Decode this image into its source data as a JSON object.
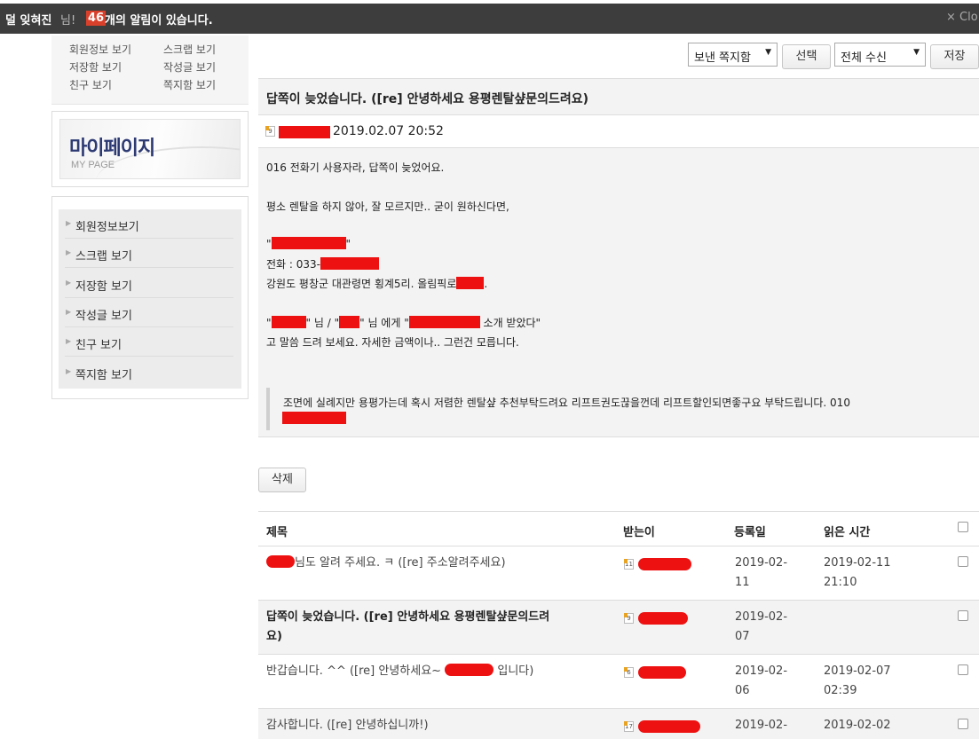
{
  "topbar": {
    "user_name": "덜 잊혀진",
    "user_suffix": "님!",
    "alert_count": "46",
    "alert_text": "개의 알림이 있습니다.",
    "close_label": "× Clo"
  },
  "sidebar": {
    "quick_links": [
      "회원정보 보기",
      "스크랩 보기",
      "저장함 보기",
      "작성글 보기",
      "친구 보기",
      "쪽지함 보기"
    ],
    "mypage_title": "마이페이지",
    "mypage_subtitle": "MY PAGE",
    "menu": [
      "회원정보보기",
      "스크랩 보기",
      "저장함 보기",
      "작성글 보기",
      "친구 보기",
      "쪽지함 보기"
    ]
  },
  "toolbar": {
    "box_select_value": "보낸 쪽지함",
    "select_button": "선택",
    "receive_select_value": "전체 수신",
    "save_button": "저장"
  },
  "message": {
    "title": "답쪽이 늦었습니다. ([re] 안녕하세요 용평렌탈샾문의드려요)",
    "datetime": "2019.02.07 20:52",
    "sender_level": "9",
    "lines": {
      "l1": "016 전화기 사용자라, 답쪽이 늦었어요.",
      "l2": "평소 렌탈을 하지 않아, 잘 모르지만.. 굳이 원하신다면,",
      "l3_open": "\"",
      "l3_close": "\"",
      "l4": "전화 : 033-",
      "l5": "강원도 평창군 대관령면 횡계5리. 올림픽로",
      "l5_end": ".",
      "l6_a": "\"",
      "l6_b": "\" 님 / \"",
      "l6_c": "\" 님 에게 \"",
      "l6_d": " 소개 받았다\"",
      "l7": "고 말씀 드려 보세요. 자세한 금액이나.. 그런건 모릅니다."
    },
    "quote": "조면에 실례지만 용평가는데 혹시 저렴한 렌탈샾 추천부탁드려요 리프트권도끊을껀데 리프트할인되면좋구요 부탁드립니다. 010"
  },
  "delete_button": "삭제",
  "table": {
    "headers": [
      "제목",
      "받는이",
      "등록일",
      "읽은 시간"
    ],
    "rows": [
      {
        "subject": "님도 알려 주세요. ㅋ ([re] 주소알려주세요)",
        "level": "11",
        "date1": "2019-02-",
        "date2": "11",
        "read1": "2019-02-11",
        "read2": "21:10"
      },
      {
        "subject": "답쪽이 늦었습니다. ([re] 안녕하세요 용평렌탈샾문의드려",
        "subject2": "요)",
        "level": "9",
        "date1": "2019-02-",
        "date2": "07",
        "read1": "",
        "read2": ""
      },
      {
        "subject": "반갑습니다. ^^ ([re] 안녕하세요~",
        "subject_end": "입니다)",
        "level": "6",
        "date1": "2019-02-",
        "date2": "06",
        "read1": "2019-02-07",
        "read2": "02:39"
      },
      {
        "subject": "감사합니다. ([re] 안녕하십니까!)",
        "level": "17",
        "date1": "2019-02-",
        "date2": "",
        "read1": "2019-02-02",
        "read2": ""
      }
    ]
  }
}
